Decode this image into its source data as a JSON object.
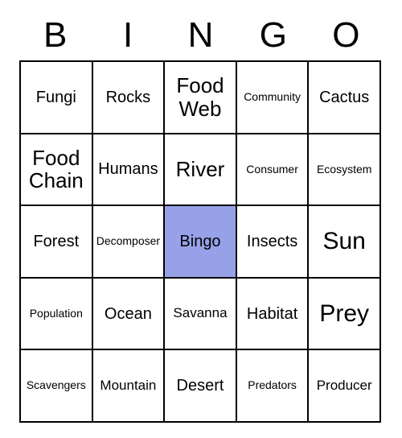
{
  "header": [
    "B",
    "I",
    "N",
    "G",
    "O"
  ],
  "cells": [
    {
      "text": "Fungi",
      "size": ""
    },
    {
      "text": "Rocks",
      "size": ""
    },
    {
      "text": "Food Web",
      "size": "large"
    },
    {
      "text": "Community",
      "size": "small"
    },
    {
      "text": "Cactus",
      "size": ""
    },
    {
      "text": "Food Chain",
      "size": "large"
    },
    {
      "text": "Humans",
      "size": ""
    },
    {
      "text": "River",
      "size": "large"
    },
    {
      "text": "Consumer",
      "size": "small"
    },
    {
      "text": "Ecosystem",
      "size": "small"
    },
    {
      "text": "Forest",
      "size": ""
    },
    {
      "text": "Decomposer",
      "size": "small"
    },
    {
      "text": "Bingo",
      "size": "",
      "free": true
    },
    {
      "text": "Insects",
      "size": ""
    },
    {
      "text": "Sun",
      "size": "xlarge"
    },
    {
      "text": "Population",
      "size": "small"
    },
    {
      "text": "Ocean",
      "size": ""
    },
    {
      "text": "Savanna",
      "size": "medium"
    },
    {
      "text": "Habitat",
      "size": ""
    },
    {
      "text": "Prey",
      "size": "xlarge"
    },
    {
      "text": "Scavengers",
      "size": "small"
    },
    {
      "text": "Mountain",
      "size": "medium"
    },
    {
      "text": "Desert",
      "size": ""
    },
    {
      "text": "Predators",
      "size": "small"
    },
    {
      "text": "Producer",
      "size": "medium"
    }
  ]
}
